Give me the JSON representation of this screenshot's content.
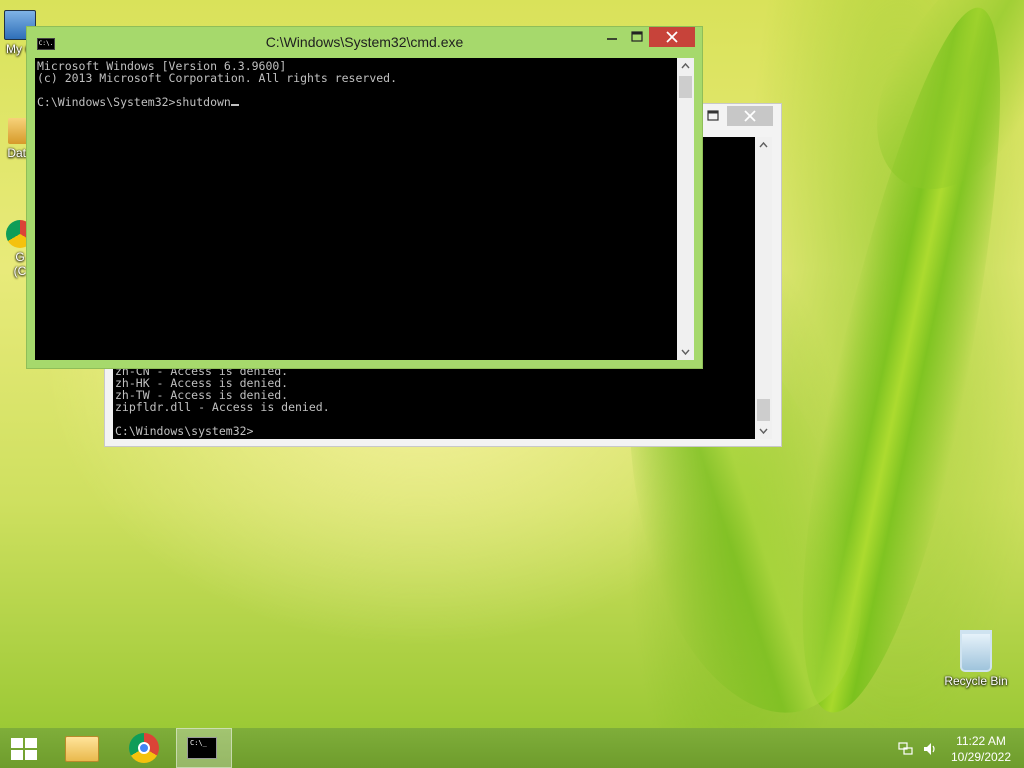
{
  "desktop": {
    "icons": [
      {
        "id": "my-computer",
        "label": "My C"
      },
      {
        "id": "data",
        "label": "Data"
      },
      {
        "id": "chrome-shortcut",
        "label": "G\n(C"
      },
      {
        "id": "recycle-bin",
        "label": "Recycle Bin"
      }
    ]
  },
  "front_window": {
    "title": "C:\\Windows\\System32\\cmd.exe",
    "icon_text": "C:\\.",
    "minimize_label": "—",
    "maximize_label": "□",
    "close_label": "✕",
    "console_lines": [
      "Microsoft Windows [Version 6.3.9600]",
      "(c) 2013 Microsoft Corporation. All rights reserved.",
      "",
      "C:\\Windows\\System32>shutdown"
    ]
  },
  "back_window": {
    "maximize_label": "□",
    "close_label": "✕",
    "console_lines": [
      "zh-CN - Access is denied.",
      "zh-HK - Access is denied.",
      "zh-TW - Access is denied.",
      "zipfldr.dll - Access is denied.",
      "",
      "C:\\Windows\\system32>"
    ]
  },
  "taskbar": {
    "pinned": [
      {
        "id": "start",
        "icon": "windows-logo-icon"
      },
      {
        "id": "file-explorer",
        "icon": "folder-icon"
      },
      {
        "id": "chrome",
        "icon": "chrome-icon"
      },
      {
        "id": "command-prompt",
        "icon": "cmd-icon",
        "icon_text": "C:\\_"
      }
    ],
    "clock": {
      "time": "11:22 AM",
      "date": "10/29/2022"
    }
  },
  "colors": {
    "front_window_frame": "#a6d96c",
    "close_button": "#c7433a",
    "taskbar": "#7fae3a",
    "console_background": "#000000",
    "console_text": "#c0c0c0"
  }
}
